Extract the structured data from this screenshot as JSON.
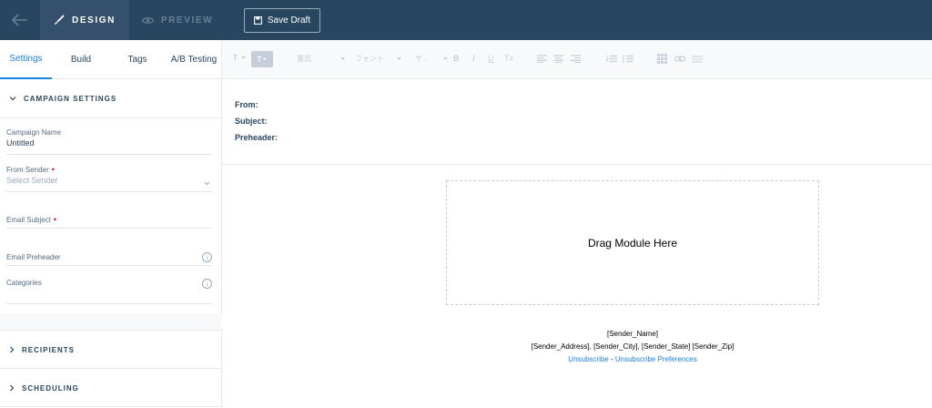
{
  "topbar": {
    "design_label": "DESIGN",
    "preview_label": "PREVIEW",
    "save_draft_label": "Save Draft",
    "colors": {
      "bar": "#294661",
      "active_tab": "#34506d"
    }
  },
  "sidebar": {
    "tabs": [
      {
        "label": "Settings",
        "active": true
      },
      {
        "label": "Build",
        "active": false
      },
      {
        "label": "Tags",
        "active": false
      },
      {
        "label": "A/B Testing",
        "active": false
      }
    ],
    "campaign_settings": {
      "title": "CAMPAIGN SETTINGS",
      "campaign_name": {
        "label": "Campaign Name",
        "value": "Untitled"
      },
      "from_sender": {
        "label": "From Sender",
        "placeholder": "Select Sender",
        "required": "•"
      },
      "email_subject": {
        "label": "Email Subject",
        "required": "•"
      },
      "email_preheader": {
        "label": "Email Preheader",
        "info": "i"
      },
      "categories": {
        "label": "Categories",
        "info": "i"
      }
    },
    "recipients_title": "RECIPIENTS",
    "scheduling_title": "SCHEDULING"
  },
  "toolbar": {
    "text_color": "T",
    "bg_color": "T",
    "style_select": "書式",
    "font_select": "フォント",
    "size_select": "サ...",
    "bold": "B",
    "italic": "I",
    "underline": "U",
    "clear_format": "Tx"
  },
  "email_header": {
    "from_label": "From:",
    "subject_label": "Subject:",
    "preheader_label": "Preheader:"
  },
  "canvas": {
    "drop_zone_text": "Drag Module Here",
    "sender_name": "[Sender_Name]",
    "sender_address": "[Sender_Address], [Sender_City], [Sender_State] [Sender_Zip]",
    "unsubscribe": "Unsubscribe",
    "separator": " - ",
    "unsubscribe_preferences": "Unsubscribe Preferences",
    "link_color": "#1a82e2"
  }
}
